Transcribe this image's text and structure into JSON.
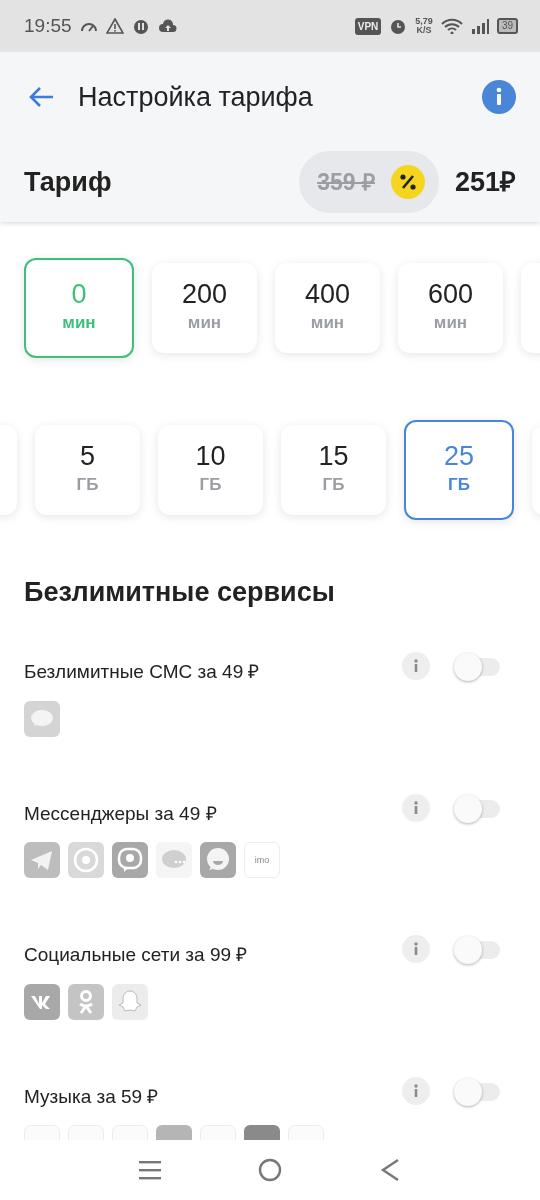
{
  "status_bar": {
    "time": "19:55",
    "vpn": "VPN",
    "speed": "5,79",
    "speed_unit": "K/S",
    "battery": "39"
  },
  "header": {
    "title": "Настройка тарифа"
  },
  "tariff": {
    "label": "Тариф",
    "old_price": "359 ₽",
    "price": "251₽"
  },
  "minutes": [
    {
      "value": "0",
      "unit": "мин",
      "selected": true
    },
    {
      "value": "200",
      "unit": "мин",
      "selected": false
    },
    {
      "value": "400",
      "unit": "мин",
      "selected": false
    },
    {
      "value": "600",
      "unit": "мин",
      "selected": false
    }
  ],
  "gigabytes": [
    {
      "value": "5",
      "unit": "ГБ",
      "selected": false
    },
    {
      "value": "10",
      "unit": "ГБ",
      "selected": false
    },
    {
      "value": "15",
      "unit": "ГБ",
      "selected": false
    },
    {
      "value": "25",
      "unit": "ГБ",
      "selected": true
    }
  ],
  "section_title": "Безлимитные сервисы",
  "services": [
    {
      "title": "Безлимитные СМС за 49 ₽",
      "on": false,
      "apps": [
        {
          "kind": "sms"
        }
      ]
    },
    {
      "title": "Мессенджеры за 49 ₽",
      "on": false,
      "apps": [
        {
          "kind": "telegram"
        },
        {
          "kind": "whatsapp"
        },
        {
          "kind": "viber"
        },
        {
          "kind": "chat"
        },
        {
          "kind": "messenger"
        },
        {
          "kind": "imo",
          "label": "imo"
        }
      ]
    },
    {
      "title": "Социальные сети за 99 ₽",
      "on": false,
      "apps": [
        {
          "kind": "vk"
        },
        {
          "kind": "ok"
        },
        {
          "kind": "ghost"
        }
      ]
    },
    {
      "title": "Музыка за 59 ₽",
      "on": false,
      "apps": [
        {
          "kind": "plain"
        },
        {
          "kind": "plain"
        },
        {
          "kind": "plain"
        },
        {
          "kind": "mid"
        },
        {
          "kind": "plain"
        },
        {
          "kind": "dark"
        },
        {
          "kind": "plain"
        }
      ]
    }
  ]
}
